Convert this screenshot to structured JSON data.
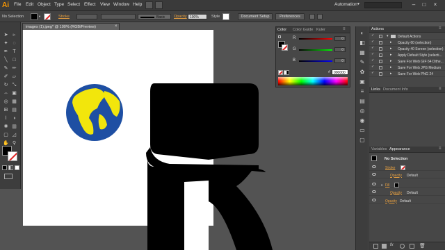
{
  "app": {
    "logo": "Ai",
    "workspace": "Automation"
  },
  "menu": [
    "File",
    "Edit",
    "Object",
    "Type",
    "Select",
    "Effect",
    "View",
    "Window",
    "Help"
  ],
  "control_bar": {
    "selection": "No Selection",
    "stroke_label": "Stroke",
    "brush_name": "Basic",
    "opacity_label": "Opacity",
    "opacity_value": "100%",
    "style_label": "Style",
    "doc_setup": "Document Setup",
    "preferences": "Preferences"
  },
  "document": {
    "tab_title": "images (1).jpeg* @ 100% (RGB/Preview)",
    "close": "×"
  },
  "color_panel": {
    "tabs": [
      "Color",
      "Color Guide",
      "Kuler"
    ],
    "channels": [
      {
        "label": "R",
        "value": "0"
      },
      {
        "label": "G",
        "value": "0"
      },
      {
        "label": "B",
        "value": "0"
      }
    ],
    "hex_prefix": "#",
    "hex": "000000"
  },
  "actions_panel": {
    "tabs": [
      "Actions"
    ],
    "items": [
      "Default Actions",
      "Opacity 60 (selection)",
      "Opacity 40 Screen (selection)",
      "Apply Default Style (selecti...",
      "Save For Web GIF 64 Dithe...",
      "Save For Web JPG Medium",
      "Save For Web PNG 24"
    ]
  },
  "links_panel": {
    "tabs": [
      "Links",
      "Document Info"
    ]
  },
  "appearance_panel": {
    "tabs": [
      "Variables",
      "Appearance"
    ],
    "title": "No Selection",
    "rows": [
      {
        "label": "Stroke",
        "value": ""
      },
      {
        "label": "Opacity",
        "value": "Default"
      },
      {
        "label": "Fill",
        "value": ""
      },
      {
        "label": "Opacity",
        "value": "Default"
      },
      {
        "label": "Opacity",
        "value": "Default"
      }
    ],
    "fx": "fx"
  },
  "colors": {
    "accent": "#e8a040",
    "globe_ocean": "#1e4fa3",
    "globe_land": "#f2e60c",
    "ui_bg": "#535353"
  }
}
